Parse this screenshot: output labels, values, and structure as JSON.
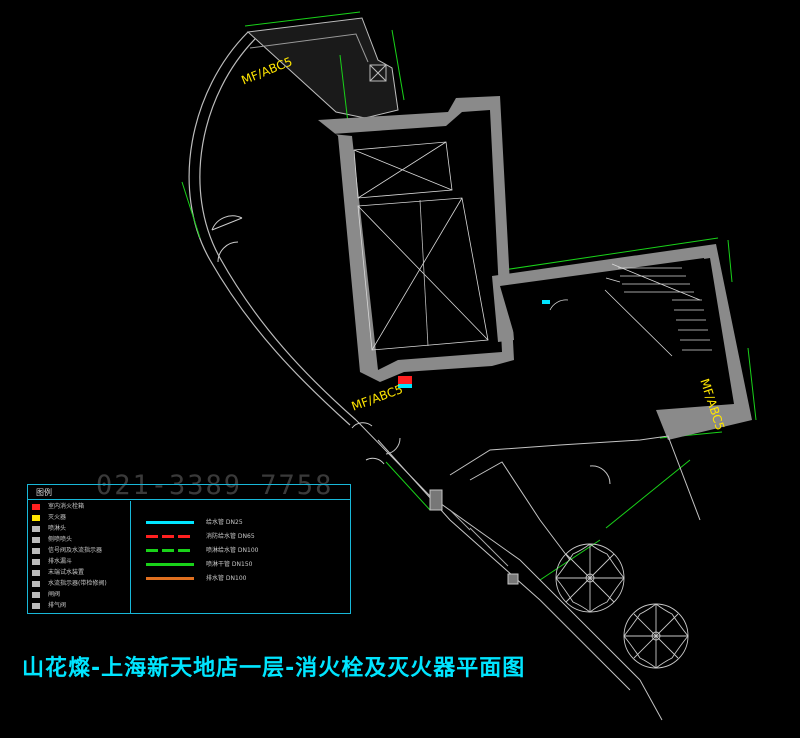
{
  "title": "山花燦-上海新天地店一层-消火栓及灭火器平面图",
  "watermark_phone": "021-3389 7758",
  "labels": {
    "mf_abc_top": "MF/ABC5",
    "mf_abc_middle": "MF/ABC5",
    "mf_abc_right": "MF/ABC5"
  },
  "colors": {
    "background": "#000000",
    "wall": "#8a8a8a",
    "line": "#e0e0e0",
    "dimension": "#19d219",
    "title": "#00e5ff",
    "legend_border": "#18b7d8",
    "label": "#ffe600",
    "hydrant": "#ff2020"
  },
  "legend": {
    "header": "图例",
    "left_items": [
      {
        "symbol": "red",
        "text": "室内消火栓箱"
      },
      {
        "symbol": "yellow",
        "text": "灭火器"
      },
      {
        "symbol": "gray",
        "text": "喷淋头"
      },
      {
        "symbol": "gray",
        "text": "侧喷喷头"
      },
      {
        "symbol": "gray",
        "text": "信号阀及水流指示器"
      },
      {
        "symbol": "gray",
        "text": "排水漏斗"
      },
      {
        "symbol": "gray",
        "text": "末端试水装置"
      },
      {
        "symbol": "gray",
        "text": "水流指示器(带检修阀)"
      },
      {
        "symbol": "gray",
        "text": "闸阀"
      },
      {
        "symbol": "gray",
        "text": "排气阀"
      }
    ],
    "right_items": [
      {
        "color": "#00e5ff",
        "dashed": false,
        "text": "给水管 DN25"
      },
      {
        "color": "#ff2020",
        "dashed": true,
        "text": "消防给水管 DN65"
      },
      {
        "color": "#19d219",
        "dashed": true,
        "text": "喷淋给水管 DN100"
      },
      {
        "color": "#19d219",
        "dashed": false,
        "text": "喷淋干管 DN150"
      },
      {
        "color": "#e07020",
        "dashed": false,
        "text": "排水管 DN100"
      }
    ]
  }
}
